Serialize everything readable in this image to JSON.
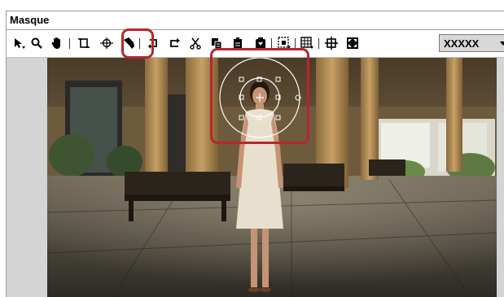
{
  "window": {
    "title": "Masque"
  },
  "toolbar": {
    "tools": [
      {
        "name": "select-arrow",
        "icon": "arrow-pointer-icon"
      },
      {
        "name": "zoom",
        "icon": "magnifier-icon"
      },
      {
        "name": "hand",
        "icon": "hand-icon"
      },
      {
        "name": "rectangle-shape",
        "icon": "rectangle-shape-icon"
      },
      {
        "name": "ellipse-shape",
        "icon": "ellipse-crosshair-icon"
      },
      {
        "name": "pen",
        "icon": "pen-icon"
      },
      {
        "name": "undo",
        "icon": "undo-icon"
      },
      {
        "name": "redo",
        "icon": "redo-icon"
      },
      {
        "name": "cut",
        "icon": "scissors-icon"
      },
      {
        "name": "copy",
        "icon": "copy-icon"
      },
      {
        "name": "paste",
        "icon": "clipboard-icon"
      },
      {
        "name": "delete",
        "icon": "delete-icon"
      },
      {
        "name": "fit-view",
        "icon": "fit-selection-icon"
      },
      {
        "name": "grid",
        "icon": "grid-icon"
      },
      {
        "name": "center",
        "icon": "center-icon"
      },
      {
        "name": "fullscreen",
        "icon": "fullscreen-icon"
      }
    ],
    "zoom_select": {
      "value": "XXXXX"
    }
  },
  "colors": {
    "highlight": "#b7262f",
    "toolbar_bg": "#ffffff",
    "panel_bg": "#d4d4d4"
  }
}
